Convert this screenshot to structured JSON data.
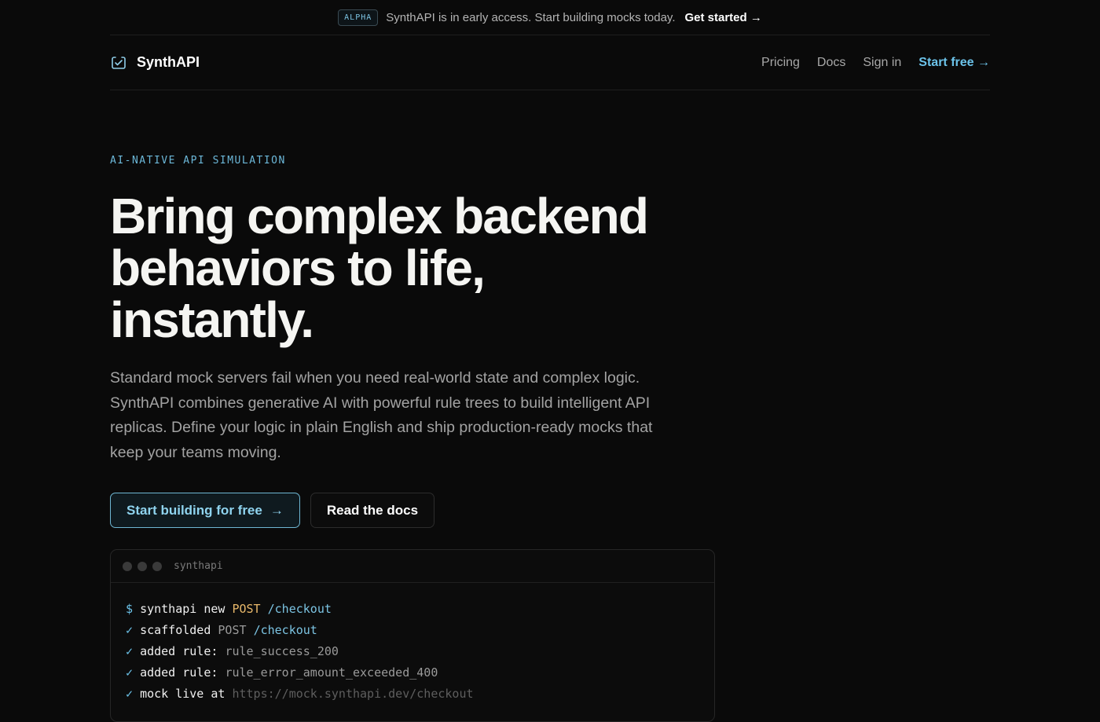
{
  "announcement": {
    "badge": "ALPHA",
    "text": "SynthAPI is in early access. Start building mocks today.",
    "link": "Get started →"
  },
  "nav": {
    "brand": "SynthAPI",
    "links": [
      "Pricing",
      "Docs",
      "Sign in"
    ],
    "cta": "Start free →"
  },
  "hero": {
    "eyebrow": "AI-NATIVE API SIMULATION",
    "headline": "Bring complex backend behaviors to life, instantly.",
    "lede": "Standard mock servers fail when you need real-world state and complex logic. SynthAPI combines generative AI with powerful rule trees to build intelligent API replicas. Define your logic in plain English and ship production-ready mocks that keep your teams moving.",
    "primary_button": "Start building for free",
    "primary_arrow": "→",
    "secondary_button": "Read the docs"
  },
  "terminal": {
    "title": "synthapi",
    "prompt": "$",
    "command": "synthapi new",
    "method": "POST",
    "path": "/checkout",
    "check": "✓",
    "line2_label": "scaffolded",
    "line3_label": "added rule:",
    "line3_value": "rule_success_200",
    "line4_label": "added rule:",
    "line4_value": "rule_error_amount_exceeded_400",
    "line5_label": "mock live at",
    "line5_value": "https://mock.synthapi.dev/checkout"
  },
  "colors": {
    "background": "#0a0a0a",
    "accent": "#6cc3ea",
    "method": "#e8b86a"
  }
}
